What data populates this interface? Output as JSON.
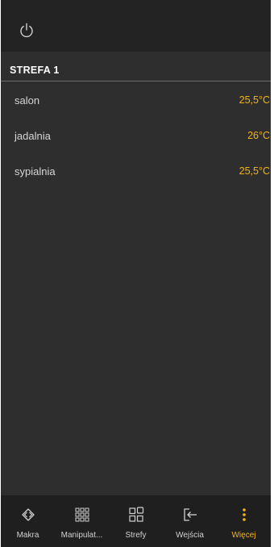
{
  "top_bar": {
    "power_icon": "power-icon"
  },
  "section": {
    "title": "STREFA 1"
  },
  "rooms": [
    {
      "name": "salon",
      "temperature": "25,5°C"
    },
    {
      "name": "jadalnia",
      "temperature": "26°C"
    },
    {
      "name": "sypialnia",
      "temperature": "25,5°C"
    }
  ],
  "bottom_nav": {
    "items": [
      {
        "label": "Makra",
        "icon": "macro-diamond-icon"
      },
      {
        "label": "Manipulat...",
        "icon": "grid-nine-icon"
      },
      {
        "label": "Strefy",
        "icon": "zones-grid-icon"
      },
      {
        "label": "Wejścia",
        "icon": "input-enter-icon"
      },
      {
        "label": "Więcej",
        "icon": "more-vertical-icon",
        "active": true
      }
    ]
  },
  "colors": {
    "background": "#2e2e2e",
    "top_bar": "#232323",
    "bottom_nav": "#1f1f1f",
    "accent": "#f3b516",
    "text": "#d6d6d6"
  }
}
